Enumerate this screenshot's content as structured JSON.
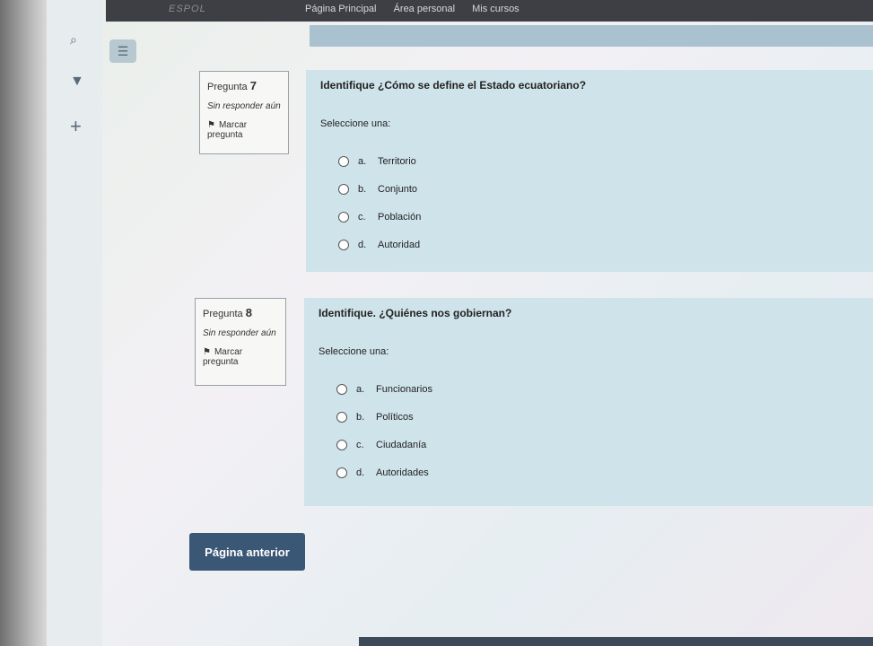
{
  "navbar": {
    "brand": "ESPOL",
    "items": [
      "Página Principal",
      "Área personal",
      "Mis cursos"
    ]
  },
  "icons": {
    "search": "search-icon",
    "menu": "menu-icon",
    "shield": "shield-icon",
    "plus": "plus-icon"
  },
  "questions": [
    {
      "number_label": "Pregunta",
      "number": "7",
      "state": "Sin responder aún",
      "flag_label_1": "Marcar",
      "flag_label_2": "pregunta",
      "text": "Identifique ¿Cómo se define el Estado ecuatoriano?",
      "prompt": "Seleccione una:",
      "options": [
        {
          "letter": "a.",
          "label": "Territorio"
        },
        {
          "letter": "b.",
          "label": "Conjunto"
        },
        {
          "letter": "c.",
          "label": "Población"
        },
        {
          "letter": "d.",
          "label": "Autoridad"
        }
      ]
    },
    {
      "number_label": "Pregunta",
      "number": "8",
      "state": "Sin responder aún",
      "flag_label_1": "Marcar",
      "flag_label_2": "pregunta",
      "text": "Identifique. ¿Quiénes nos gobiernan?",
      "prompt": "Seleccione una:",
      "options": [
        {
          "letter": "a.",
          "label": "Funcionarios"
        },
        {
          "letter": "b.",
          "label": "Políticos"
        },
        {
          "letter": "c.",
          "label": "Ciudadanía"
        },
        {
          "letter": "d.",
          "label": "Autoridades"
        }
      ]
    }
  ],
  "buttons": {
    "previous": "Página anterior"
  }
}
